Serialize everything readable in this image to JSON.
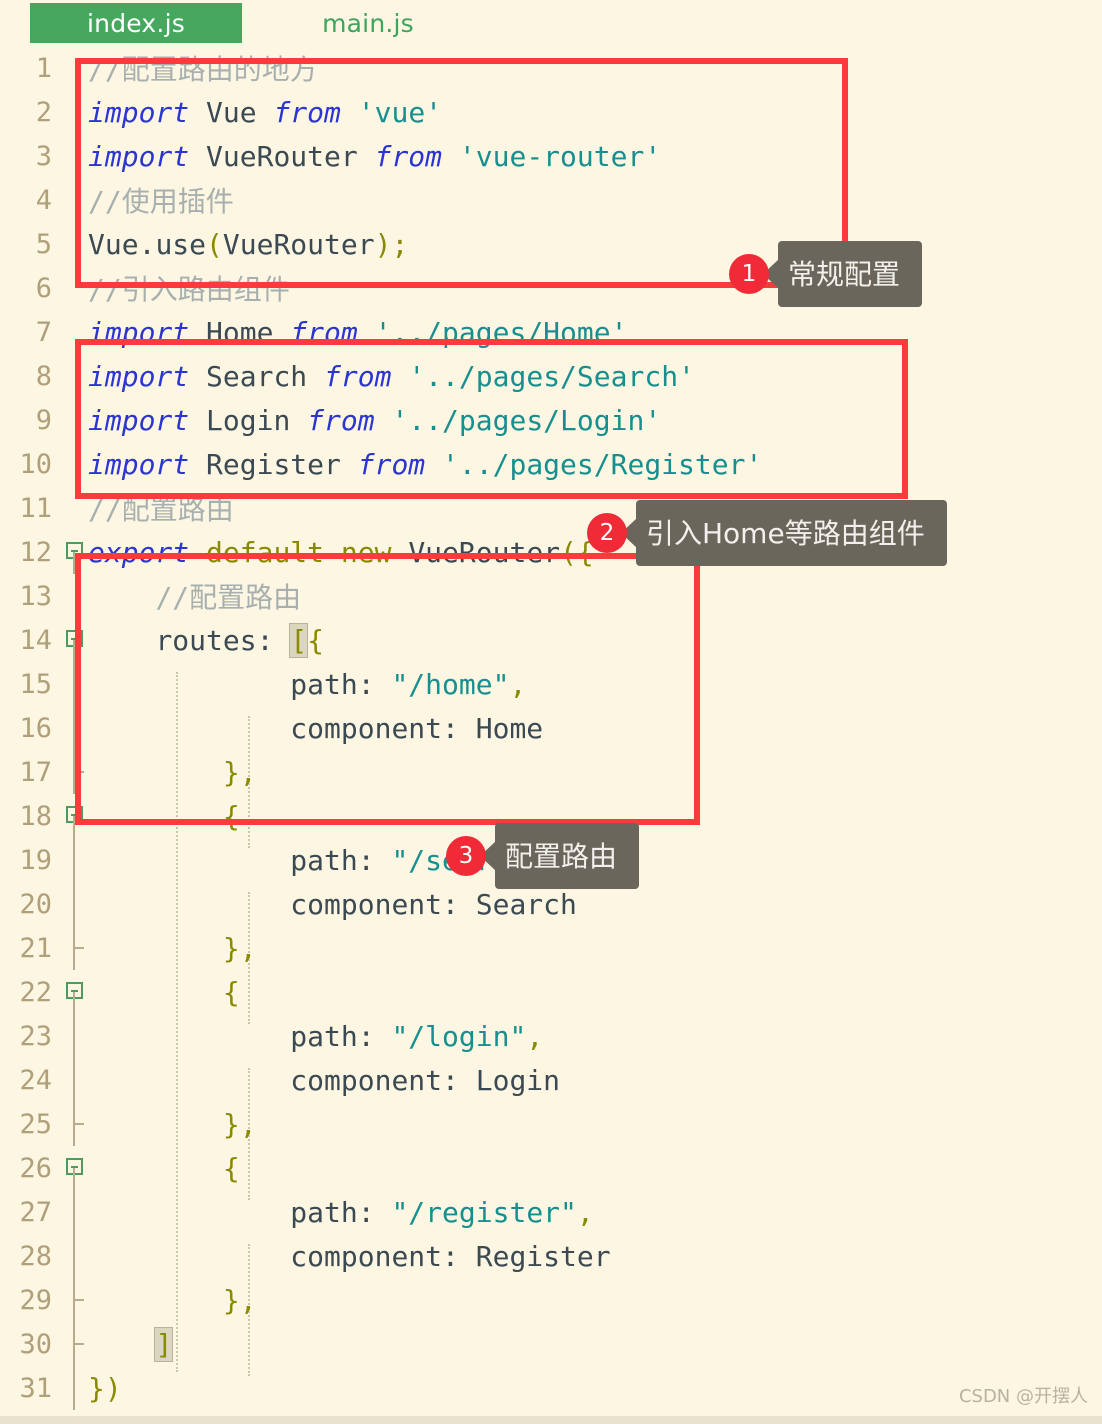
{
  "tabs": [
    {
      "label": "index.js",
      "active": true
    },
    {
      "label": "main.js",
      "active": false
    }
  ],
  "colors": {
    "background": "#fdf6e3",
    "tab_active_bg": "#45a85e",
    "tab_inactive_text": "#3ea35b",
    "annotation_red": "#f93b3b",
    "badge_red": "#f02b37",
    "callout_gray": "#6b665c",
    "comment": "#a7b0ae",
    "keyword": "#2b35d0",
    "string": "#178f8f",
    "operator": "#8a8a00",
    "identifier": "#3b4a52",
    "line_number": "#b0a07a"
  },
  "editor": {
    "lines": [
      {
        "n": "1",
        "text": "//配置路由的地方"
      },
      {
        "n": "2",
        "text": "import Vue from 'vue'"
      },
      {
        "n": "3",
        "text": "import VueRouter from 'vue-router'"
      },
      {
        "n": "4",
        "text": "//使用插件"
      },
      {
        "n": "5",
        "text": "Vue.use(VueRouter);"
      },
      {
        "n": "6",
        "text": "//引入路由组件"
      },
      {
        "n": "7",
        "text": "import Home from '../pages/Home'"
      },
      {
        "n": "8",
        "text": "import Search from '../pages/Search'"
      },
      {
        "n": "9",
        "text": "import Login from '../pages/Login'"
      },
      {
        "n": "10",
        "text": "import Register from '../pages/Register'"
      },
      {
        "n": "11",
        "text": "//配置路由"
      },
      {
        "n": "12",
        "text": "export default new VueRouter({"
      },
      {
        "n": "13",
        "text": "    //配置路由"
      },
      {
        "n": "14",
        "text": "    routes: [{"
      },
      {
        "n": "15",
        "text": "            path: \"/home\","
      },
      {
        "n": "16",
        "text": "            component: Home"
      },
      {
        "n": "17",
        "text": "        },"
      },
      {
        "n": "18",
        "text": "        {"
      },
      {
        "n": "19",
        "text": "            path: \"/search\","
      },
      {
        "n": "20",
        "text": "            component: Search"
      },
      {
        "n": "21",
        "text": "        },"
      },
      {
        "n": "22",
        "text": "        {"
      },
      {
        "n": "23",
        "text": "            path: \"/login\","
      },
      {
        "n": "24",
        "text": "            component: Login"
      },
      {
        "n": "25",
        "text": "        },"
      },
      {
        "n": "26",
        "text": "        {"
      },
      {
        "n": "27",
        "text": "            path: \"/register\","
      },
      {
        "n": "28",
        "text": "            component: Register"
      },
      {
        "n": "29",
        "text": "        },"
      },
      {
        "n": "30",
        "text": "    ]"
      },
      {
        "n": "31",
        "text": "})"
      }
    ]
  },
  "annotations": [
    {
      "num": "1",
      "label": "常规配置"
    },
    {
      "num": "2",
      "label": "引入Home等路由组件"
    },
    {
      "num": "3",
      "label": "配置路由"
    }
  ],
  "watermark": "CSDN @开摆人"
}
